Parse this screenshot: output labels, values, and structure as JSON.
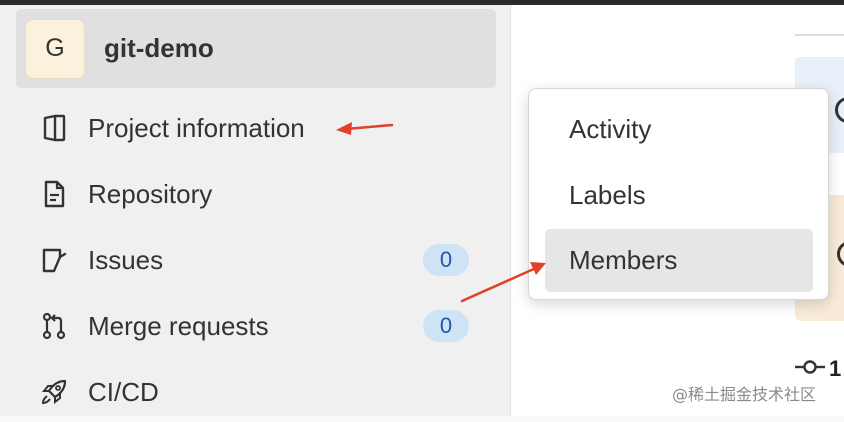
{
  "project": {
    "avatar_letter": "G",
    "name": "git-demo"
  },
  "sidebar": {
    "items": [
      {
        "label": "Project information",
        "icon": "project-information-icon"
      },
      {
        "label": "Repository",
        "icon": "document-icon"
      },
      {
        "label": "Issues",
        "icon": "issues-icon",
        "count": "0"
      },
      {
        "label": "Merge requests",
        "icon": "merge-request-icon",
        "count": "0"
      },
      {
        "label": "CI/CD",
        "icon": "rocket-icon"
      }
    ]
  },
  "flyout": {
    "items": [
      {
        "label": "Activity"
      },
      {
        "label": "Labels"
      },
      {
        "label": "Members",
        "active": true
      }
    ]
  },
  "main": {
    "commit_count_partial": "1"
  },
  "annotations": {
    "arrow_color": "#e0412a"
  },
  "watermark": "@稀土掘金技术社区",
  "colors": {
    "badge_bg": "#cfe3f7",
    "badge_text": "#1f5aa8",
    "header_bg": "#e0e0e0",
    "avatar_bg": "#fbf1dc"
  }
}
